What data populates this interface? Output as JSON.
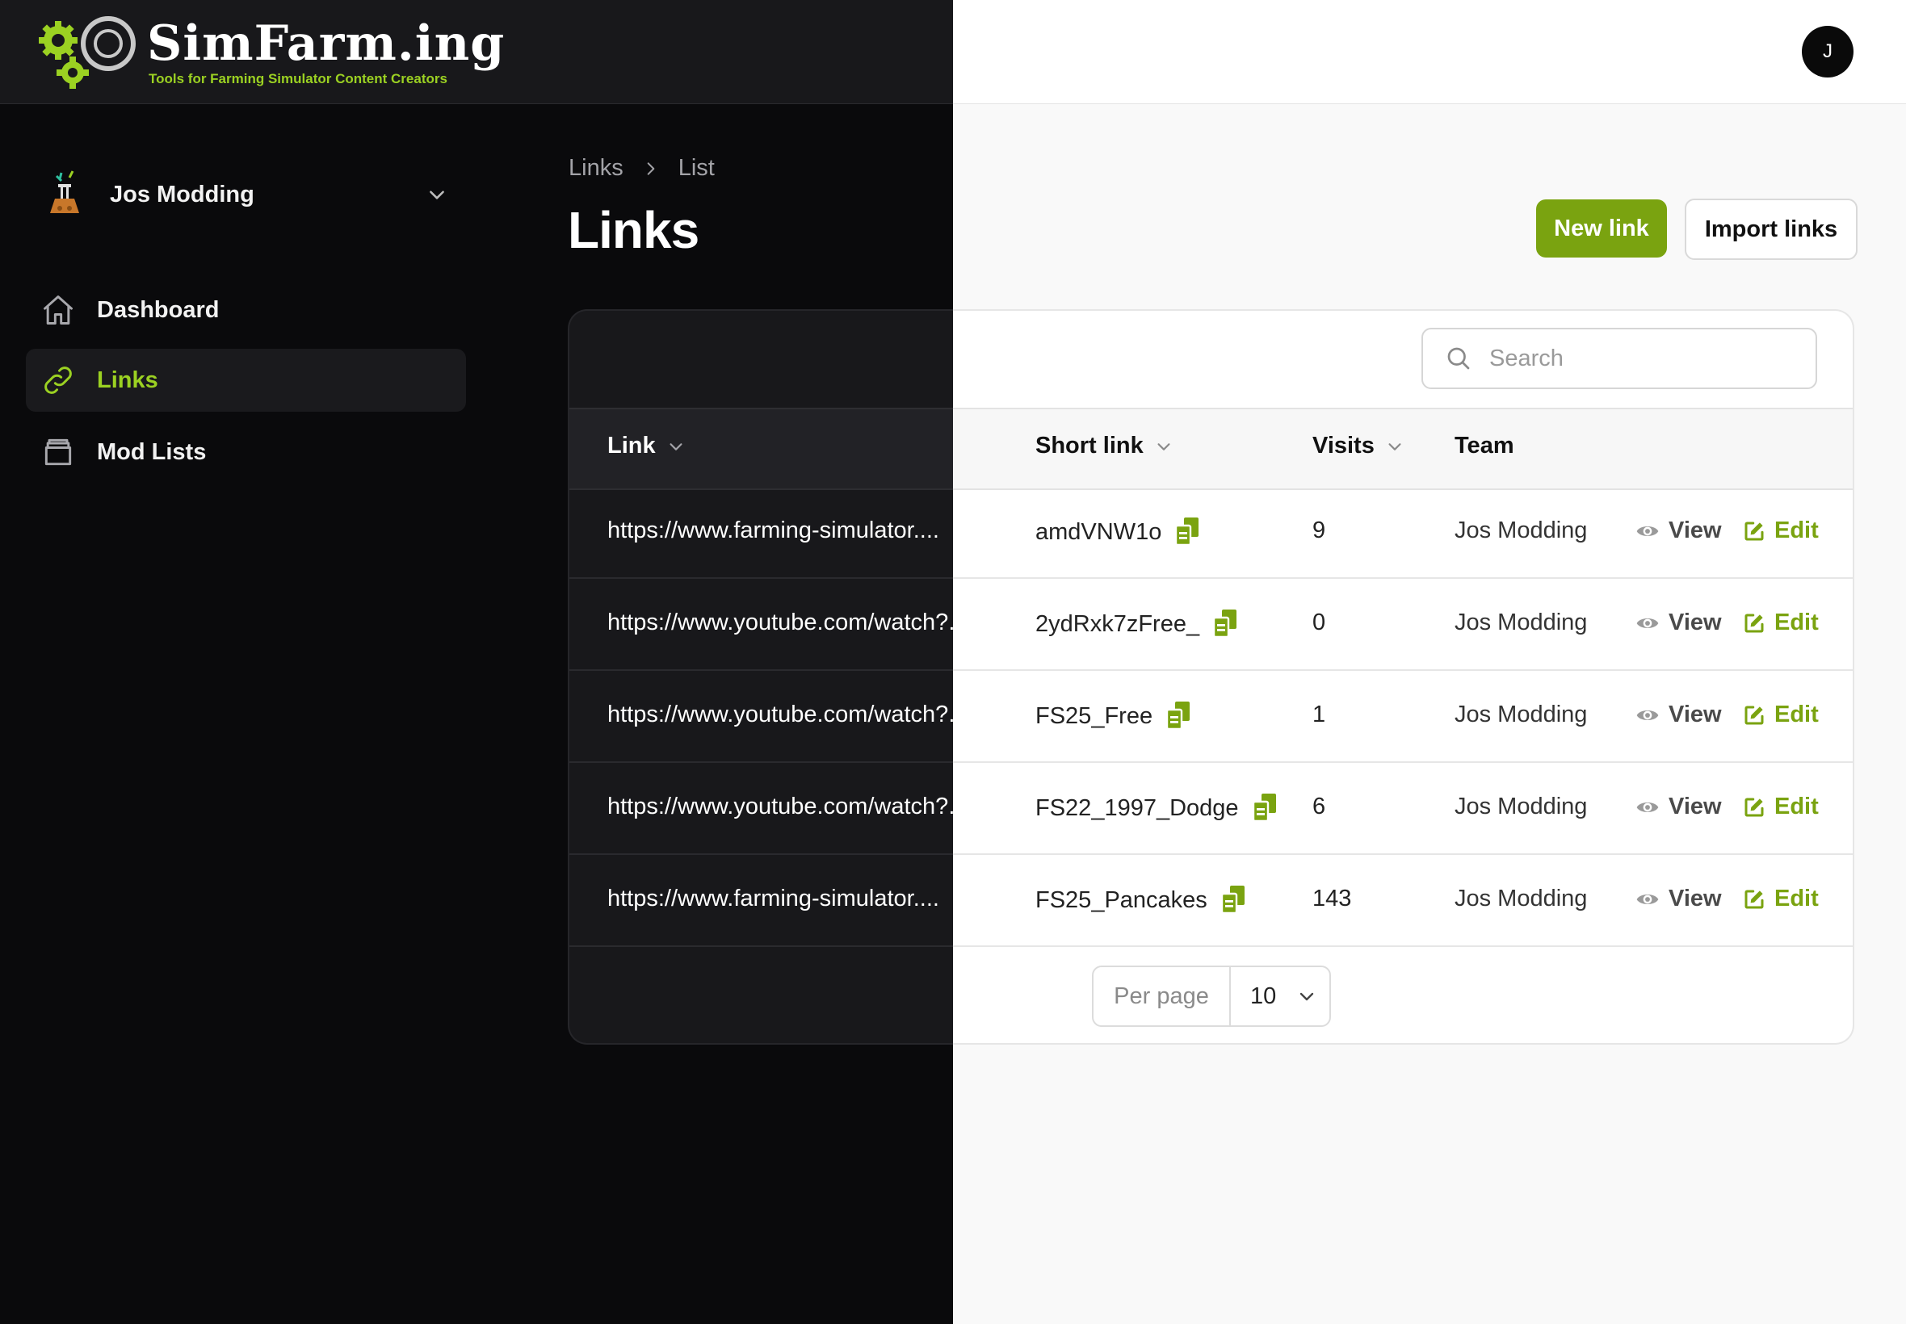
{
  "brand": {
    "title": "SimFarm.ing",
    "subtitle": "Tools for Farming Simulator Content Creators",
    "accent": "#7aa310",
    "accent_light": "#9bd122"
  },
  "user": {
    "avatar_initial": "J"
  },
  "team": {
    "name": "Jos Modding"
  },
  "sidebar": {
    "items": [
      {
        "label": "Dashboard",
        "icon": "home-icon",
        "active": false
      },
      {
        "label": "Links",
        "icon": "link-icon",
        "active": true
      },
      {
        "label": "Mod Lists",
        "icon": "archive-icon",
        "active": false
      }
    ]
  },
  "breadcrumb": {
    "items": [
      "Links",
      "List"
    ]
  },
  "page": {
    "title": "Links"
  },
  "actions": {
    "new_label": "New link",
    "import_label": "Import links"
  },
  "search": {
    "placeholder": "Search",
    "value": ""
  },
  "table": {
    "columns": [
      "Link",
      "Short link",
      "Visits",
      "Team"
    ],
    "rows": [
      {
        "link": "https://www.farming-simulator....",
        "short": "amdVNW1o",
        "visits": "9",
        "team": "Jos Modding"
      },
      {
        "link": "https://www.youtube.com/watch?...",
        "short": "2ydRxk7zFree_",
        "visits": "0",
        "team": "Jos Modding"
      },
      {
        "link": "https://www.youtube.com/watch?...",
        "short": "FS25_Free",
        "visits": "1",
        "team": "Jos Modding"
      },
      {
        "link": "https://www.youtube.com/watch?...",
        "short": "FS22_1997_Dodge",
        "visits": "6",
        "team": "Jos Modding"
      },
      {
        "link": "https://www.farming-simulator....",
        "short": "FS25_Pancakes",
        "visits": "143",
        "team": "Jos Modding"
      }
    ],
    "view_label": "View",
    "edit_label": "Edit"
  },
  "pagination": {
    "per_page_label": "Per page",
    "per_page_value": "10"
  }
}
